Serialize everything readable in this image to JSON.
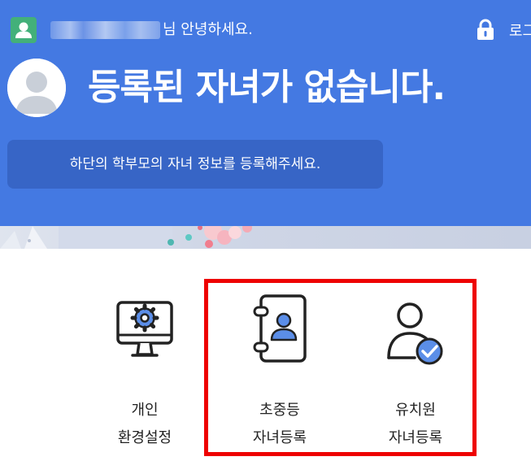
{
  "header": {
    "greeting": "님 안녕하세요.",
    "login_label": "로그"
  },
  "hero": {
    "title": "등록된 자녀가 없습니다.",
    "notice": "하단의 학부모의 자녀 정보를 등록해주세요."
  },
  "menu": [
    {
      "line1": "개인",
      "line2": "환경설정",
      "icon": "monitor-gear-icon"
    },
    {
      "line1": "초중등",
      "line2": "자녀등록",
      "icon": "contact-book-icon"
    },
    {
      "line1": "유치원",
      "line2": "자녀등록",
      "icon": "user-check-icon"
    }
  ],
  "colors": {
    "hero_bg": "#4479e2",
    "notice_bg": "#3765c6",
    "accent": "#5b8ee8",
    "highlight": "#ee0000",
    "user_badge": "#43b07a"
  }
}
